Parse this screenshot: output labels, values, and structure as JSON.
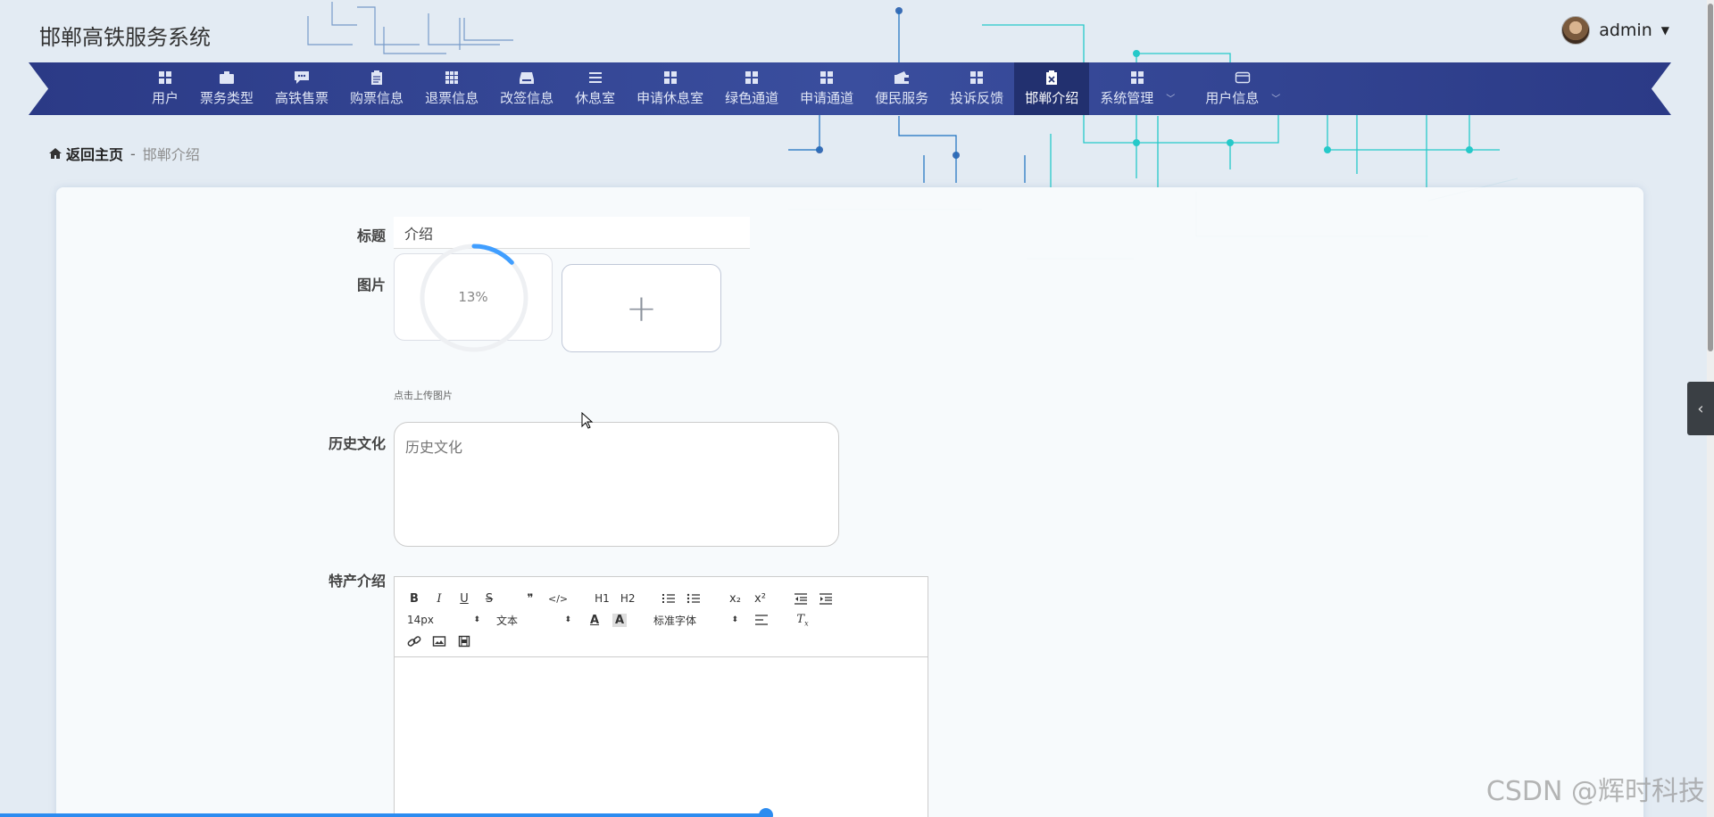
{
  "header": {
    "app_title": "邯郸高铁服务系统",
    "username": "admin"
  },
  "nav": {
    "items": [
      {
        "label": "用户",
        "icon": "grid-icon"
      },
      {
        "label": "票务类型",
        "icon": "briefcase-icon"
      },
      {
        "label": "高铁售票",
        "icon": "chat-icon"
      },
      {
        "label": "购票信息",
        "icon": "clipboard-icon"
      },
      {
        "label": "退票信息",
        "icon": "grid-icon"
      },
      {
        "label": "改签信息",
        "icon": "inbox-icon"
      },
      {
        "label": "休息室",
        "icon": "list-icon"
      },
      {
        "label": "申请休息室",
        "icon": "grid-icon"
      },
      {
        "label": "绿色通道",
        "icon": "grid-icon"
      },
      {
        "label": "申请通道",
        "icon": "grid-icon"
      },
      {
        "label": "便民服务",
        "icon": "wallet-icon"
      },
      {
        "label": "投诉反馈",
        "icon": "grid-icon"
      },
      {
        "label": "邯郸介绍",
        "icon": "clipboard-x-icon",
        "active": true
      },
      {
        "label": "系统管理",
        "icon": "grid-icon",
        "dropdown": true
      },
      {
        "label": "用户信息",
        "icon": "card-icon",
        "dropdown": true
      }
    ]
  },
  "breadcrumb": {
    "home": "返回主页",
    "separator": "-",
    "current": "邯郸介绍"
  },
  "form": {
    "title_label": "标题",
    "title_value": "介绍",
    "image_label": "图片",
    "upload_progress_text": "13%",
    "upload_progress": 0.13,
    "upload_hint": "点击上传图片",
    "history_label": "历史文化",
    "history_placeholder": "历史文化",
    "specialty_label": "特产介绍"
  },
  "editor": {
    "toolbar_row1": [
      "B",
      "I",
      "U",
      "S",
      "❞",
      "</>",
      "H1",
      "H2",
      "ol",
      "ul",
      "x₂",
      "x²",
      "outdent",
      "indent"
    ],
    "font_size": "14px",
    "header_select": "文本",
    "font_family": "标准字体"
  },
  "watermark": "CSDN @辉时科技",
  "colors": {
    "nav_bg": "#34448f",
    "nav_active": "#22306f",
    "accent": "#2d8cf0",
    "circuit": "#1fc7c7"
  }
}
